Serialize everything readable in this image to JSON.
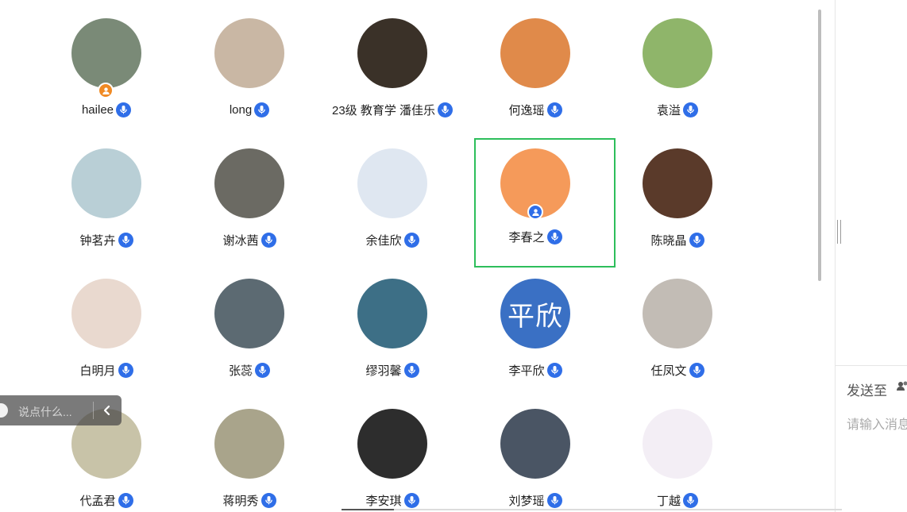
{
  "participants": [
    {
      "name": "hailee",
      "avatar_color": "#7a8a77",
      "avatar_text": "",
      "host": true
    },
    {
      "name": "long",
      "avatar_color": "#c9b7a4",
      "avatar_text": ""
    },
    {
      "name": "23级 教育学 潘佳乐",
      "avatar_color": "#3a3128",
      "avatar_text": ""
    },
    {
      "name": "何逸瑶",
      "avatar_color": "#e08a4a",
      "avatar_text": ""
    },
    {
      "name": "袁溢",
      "avatar_color": "#8fb56a",
      "avatar_text": ""
    },
    {
      "name": "钟茗卉",
      "avatar_color": "#b9cfd6",
      "avatar_text": ""
    },
    {
      "name": "谢冰茜",
      "avatar_color": "#6b6a63",
      "avatar_text": ""
    },
    {
      "name": "余佳欣",
      "avatar_color": "#dfe7f1",
      "avatar_text": ""
    },
    {
      "name": "李春之",
      "avatar_color": "#f59a5a",
      "avatar_text": "",
      "selected": true
    },
    {
      "name": "陈晓晶",
      "avatar_color": "#5a3a2a",
      "avatar_text": ""
    },
    {
      "name": "白明月",
      "avatar_color": "#e9d9cf",
      "avatar_text": ""
    },
    {
      "name": "张蕊",
      "avatar_color": "#5c6a72",
      "avatar_text": ""
    },
    {
      "name": "缪羽馨",
      "avatar_color": "#3d6f86",
      "avatar_text": ""
    },
    {
      "name": "李平欣",
      "avatar_color": "#3a70c4",
      "avatar_text": "平欣"
    },
    {
      "name": "任凤文",
      "avatar_color": "#c2bcb5",
      "avatar_text": ""
    },
    {
      "name": "代孟君",
      "avatar_color": "#c8c3a8",
      "avatar_text": ""
    },
    {
      "name": "蒋明秀",
      "avatar_color": "#a9a48b",
      "avatar_text": ""
    },
    {
      "name": "李安琪",
      "avatar_color": "#2d2d2d",
      "avatar_text": ""
    },
    {
      "name": "刘梦瑶",
      "avatar_color": "#4a5564",
      "avatar_text": ""
    },
    {
      "name": "丁越",
      "avatar_color": "#f3eef5",
      "avatar_text": ""
    }
  ],
  "chat_input": {
    "placeholder": "说点什么..."
  },
  "right_panel": {
    "send_to_label": "发送至",
    "message_placeholder": "请输入消息"
  },
  "colors": {
    "mic": "#2f6ee8",
    "selected_border": "#2dbe5b",
    "host_badge": "#f08a24"
  },
  "icons": {
    "mic": "mic-icon",
    "host": "host-badge-icon",
    "collapse": "chevron-left-icon",
    "recipients": "people-icon"
  }
}
